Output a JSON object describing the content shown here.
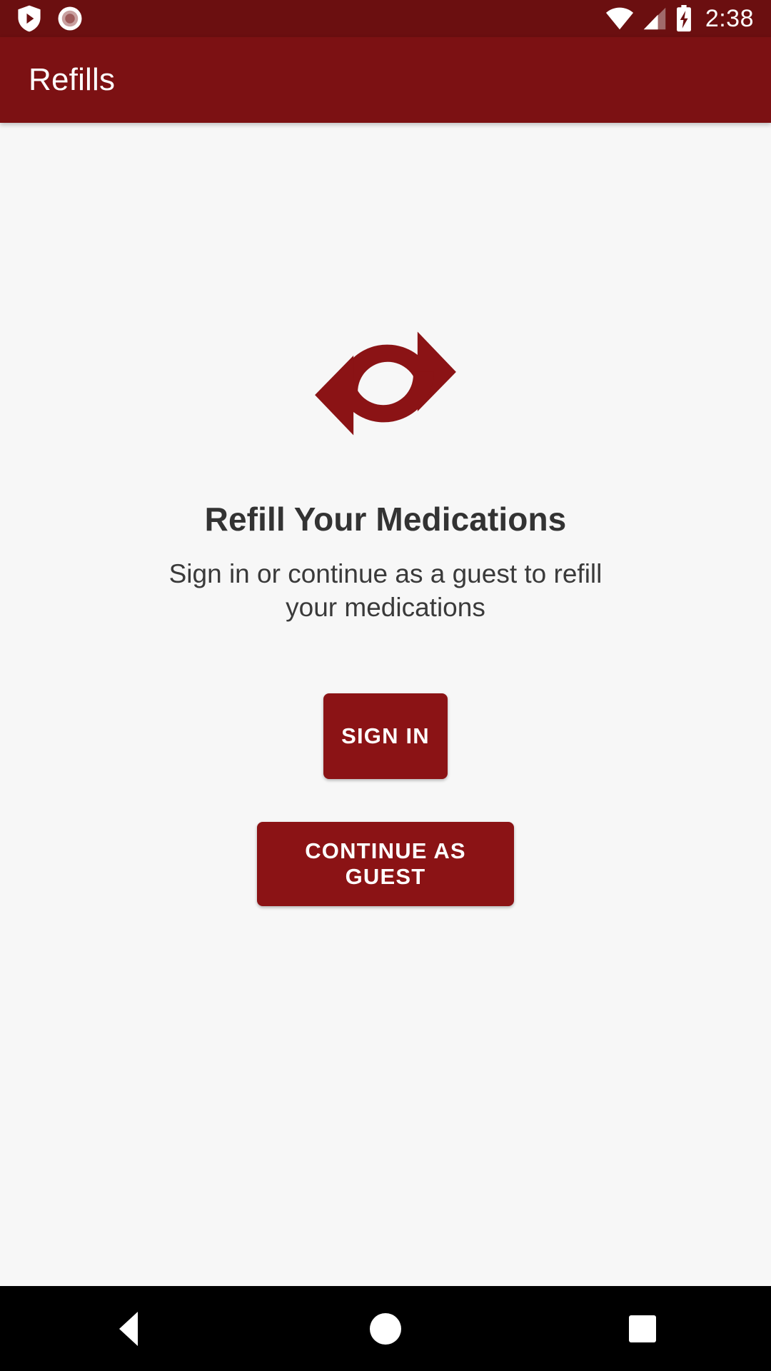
{
  "status_bar": {
    "background": "#6b0f10",
    "time": "2:38",
    "icons": [
      {
        "name": "play-protect-shield-icon",
        "side": "left"
      },
      {
        "name": "screen-record-icon",
        "side": "left"
      },
      {
        "name": "wifi-icon",
        "side": "right"
      },
      {
        "name": "cellular-signal-icon",
        "side": "right"
      },
      {
        "name": "battery-charging-icon",
        "side": "right"
      }
    ]
  },
  "app_bar": {
    "title": "Refills",
    "background": "#7c1113",
    "text_color": "#ffffff"
  },
  "main": {
    "hero_icon": "refresh-cycle-icon",
    "hero_icon_color": "#8b1315",
    "headline": "Refill Your Medications",
    "subtitle": "Sign in or continue as a guest to refill your medications",
    "buttons": [
      {
        "name": "sign-in-button",
        "label": "SIGN IN",
        "background": "#8b1315",
        "text_color": "#ffffff"
      },
      {
        "name": "continue-as-guest-button",
        "label": "CONTINUE AS GUEST",
        "background": "#8b1315",
        "text_color": "#ffffff"
      }
    ]
  },
  "nav_bar": {
    "background": "#000000",
    "buttons": [
      {
        "name": "nav-back-button",
        "label": "Back"
      },
      {
        "name": "nav-home-button",
        "label": "Home"
      },
      {
        "name": "nav-recents-button",
        "label": "Recents"
      }
    ]
  }
}
